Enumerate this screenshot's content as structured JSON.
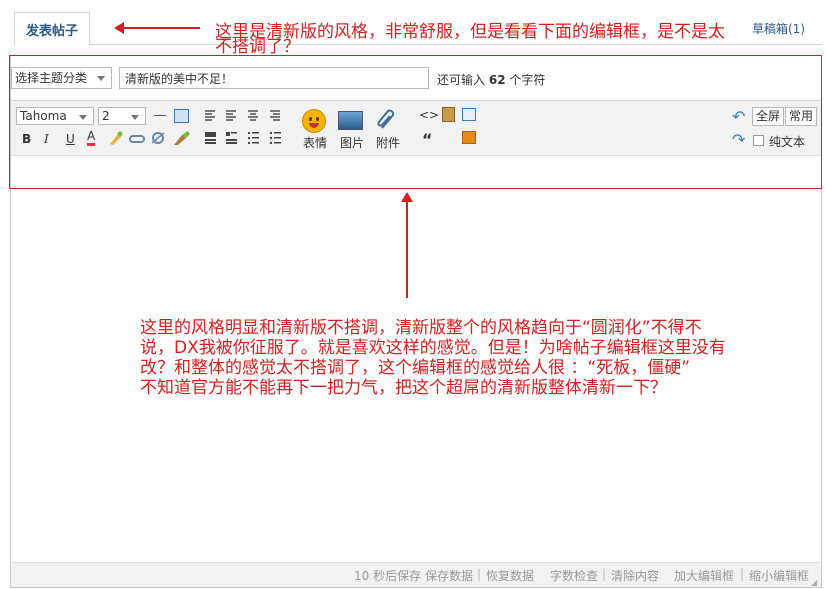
{
  "tab": {
    "label": "发表帖子",
    "draft_label": "草稿箱(1)"
  },
  "annotations": {
    "top_note": [
      "这里是清新版的风格，非常舒服，但是看看下面的编辑框，是不是太",
      "不搭调了？"
    ],
    "bottom_note": [
      "这里的风格明显和清新版不搭调，清新版整个的风格趋向于“圆润化”不得不",
      "说，DX我被你征服了。就是喜欢这样的感觉。但是！为啥帖子编辑框这里没有",
      "改？和整体的感觉太不搭调了，这个编辑框的感觉给人很 ：“死板，僵硬”",
      "不知道官方能不能再下一把力气，把这个超屌的清新版整体清新一下？"
    ],
    "color": "#d42020"
  },
  "form": {
    "category_select": "选择主题分类",
    "title_value": "清新版的美中不足！",
    "remain_prefix": "还可输入",
    "remain_count": "62",
    "remain_suffix": "个字符"
  },
  "toolbar": {
    "font_select": "Tahoma",
    "size_select": "2",
    "bold": "B",
    "italic": "I",
    "underline": "U",
    "font_color": "A",
    "emoji_label": "表情",
    "image_label": "图片",
    "attach_label": "附件",
    "quote_glyph": "“",
    "code_glyph": "<>",
    "fullscreen_label": "全屏",
    "common_label": "常用",
    "plaintext_label": "纯文本"
  },
  "footer": {
    "autosave": "10 秒后保存",
    "save_data": "保存数据",
    "restore_data": "恢复数据",
    "word_check": "字数检查",
    "clear_content": "清除内容",
    "enlarge": "加大编辑框",
    "shrink": "缩小编辑框"
  }
}
